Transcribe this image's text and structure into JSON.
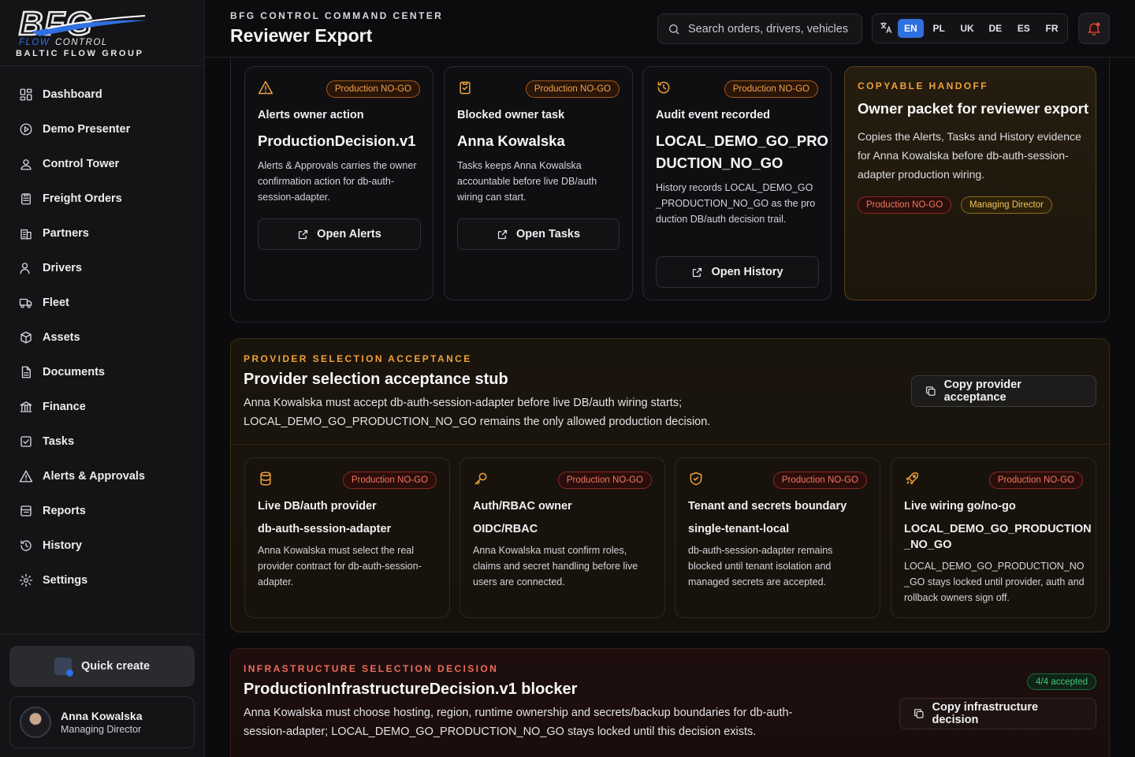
{
  "brand": {
    "logo_text": "BFG",
    "logo_sub": "FLOWCONTROL",
    "tagline": "BALTIC FLOW GROUP"
  },
  "sidebar": {
    "items": [
      {
        "label": "Dashboard",
        "icon": "dashboard-icon"
      },
      {
        "label": "Demo Presenter",
        "icon": "play-icon"
      },
      {
        "label": "Control Tower",
        "icon": "user-pin-icon"
      },
      {
        "label": "Freight Orders",
        "icon": "clipboard-icon"
      },
      {
        "label": "Partners",
        "icon": "building-icon"
      },
      {
        "label": "Drivers",
        "icon": "user-icon"
      },
      {
        "label": "Fleet",
        "icon": "truck-icon"
      },
      {
        "label": "Assets",
        "icon": "box-icon"
      },
      {
        "label": "Documents",
        "icon": "file-icon"
      },
      {
        "label": "Finance",
        "icon": "bank-icon"
      },
      {
        "label": "Tasks",
        "icon": "check-square-icon"
      },
      {
        "label": "Alerts & Approvals",
        "icon": "warning-icon"
      },
      {
        "label": "Reports",
        "icon": "report-icon"
      },
      {
        "label": "History",
        "icon": "history-icon"
      },
      {
        "label": "Settings",
        "icon": "gear-icon"
      }
    ],
    "quick_create": "Quick create",
    "user": {
      "name": "Anna Kowalska",
      "role": "Managing Director"
    }
  },
  "header": {
    "eyebrow": "BFG CONTROL COMMAND CENTER",
    "title": "Reviewer Export",
    "search_placeholder": "Search orders, drivers, vehicles",
    "languages": [
      "EN",
      "PL",
      "UK",
      "DE",
      "ES",
      "FR"
    ],
    "active_language": "EN"
  },
  "owner_cards": [
    {
      "icon": "warning-icon",
      "badge": "Production NO-GO",
      "kicker": "Alerts owner action",
      "value": "ProductionDecision.v1",
      "desc": "Alerts & Approvals carries the owner confirmation action for db-auth-session-adapter.",
      "button": "Open Alerts"
    },
    {
      "icon": "clipboard-check-icon",
      "badge": "Production NO-GO",
      "kicker": "Blocked owner task",
      "value": "Anna Kowalska",
      "desc": "Tasks keeps Anna Kowalska accountable before live DB/auth wiring can start.",
      "button": "Open Tasks"
    },
    {
      "icon": "history-icon",
      "badge": "Production NO-GO",
      "kicker": "Audit event recorded",
      "value_line1": "LOCAL_DEMO_GO_PRO",
      "value_line2": "DUCTION_NO_GO",
      "desc": "History records LOCAL_DEMO_GO_PRODUCTION_NO_GO as the production DB/auth decision trail.",
      "button": "Open History"
    }
  ],
  "handoff": {
    "eyebrow": "COPYABLE HANDOFF",
    "title": "Owner packet for reviewer export",
    "desc": "Copies the Alerts, Tasks and History evidence for Anna Kowalska before db-auth-session-adapter production wiring.",
    "badges": [
      "Production NO-GO",
      "Managing Director"
    ]
  },
  "provider": {
    "eyebrow": "PROVIDER SELECTION ACCEPTANCE",
    "title": "Provider selection acceptance stub",
    "desc_line1": "Anna Kowalska must accept db-auth-session-adapter before live DB/auth wiring starts;",
    "desc_line2": "LOCAL_DEMO_GO_PRODUCTION_NO_GO remains the only allowed production decision.",
    "button": "Copy provider acceptance",
    "cards": [
      {
        "icon": "database-icon",
        "badge": "Production NO-GO",
        "kicker": "Live DB/auth provider",
        "value": "db-auth-session-adapter",
        "desc": "Anna Kowalska must select the real provider contract for db-auth-session-adapter."
      },
      {
        "icon": "key-icon",
        "badge": "Production NO-GO",
        "kicker": "Auth/RBAC owner",
        "value": "OIDC/RBAC",
        "desc": "Anna Kowalska must confirm roles, claims and secret handling before live users are connected."
      },
      {
        "icon": "shield-check-icon",
        "badge": "Production NO-GO",
        "kicker": "Tenant and secrets boundary",
        "value": "single-tenant-local",
        "desc": "db-auth-session-adapter remains blocked until tenant isolation and managed secrets are accepted."
      },
      {
        "icon": "rocket-icon",
        "badge": "Production NO-GO",
        "kicker": "Live wiring go/no-go",
        "value_line1": "LOCAL_DEMO_GO_PRODUCTION",
        "value_line2": "_NO_GO",
        "desc": "LOCAL_DEMO_GO_PRODUCTION_NO_GO stays locked until provider, auth and rollback owners sign off."
      }
    ]
  },
  "infrastructure": {
    "eyebrow": "INFRASTRUCTURE SELECTION DECISION",
    "title": "ProductionInfrastructureDecision.v1 blocker",
    "desc_line1": "Anna Kowalska must choose hosting, region, runtime ownership and secrets/backup boundaries for db-auth-",
    "desc_line2": "session-adapter; LOCAL_DEMO_GO_PRODUCTION_NO_GO stays locked until this decision exists.",
    "accepted_badge": "4/4 accepted",
    "button": "Copy infrastructure decision"
  },
  "colors": {
    "accent_blue": "#2f6fe0",
    "nogo_orange": "#f1a04c",
    "nogo_red": "#f07660",
    "eyebrow_orange": "#f0a03c",
    "eyebrow_red": "#f06a5a",
    "accepted_green": "#47c474"
  }
}
